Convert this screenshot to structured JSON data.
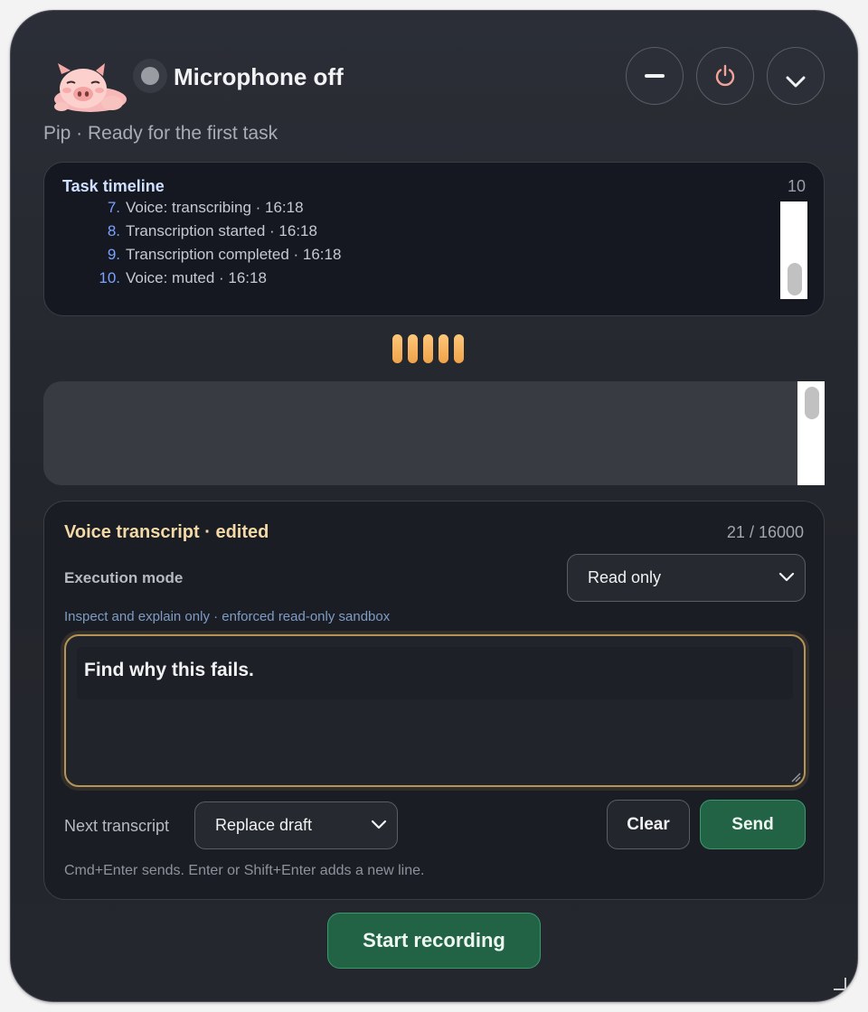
{
  "header": {
    "status_text": "Microphone off",
    "subtitle": "Pip · Ready for the first task",
    "buttons": [
      "minimize-icon",
      "power-icon",
      "chevron-down-icon"
    ],
    "colors": {
      "power_icon": "#f4a39a",
      "status_dot": "#9a9ca3"
    }
  },
  "timeline": {
    "title": "Task timeline",
    "count": "10",
    "items": [
      {
        "num": "7.",
        "text": "Voice: transcribing · 16:18"
      },
      {
        "num": "8.",
        "text": "Transcription started · 16:18"
      },
      {
        "num": "9.",
        "text": "Transcription completed · 16:18"
      },
      {
        "num": "10.",
        "text": "Voice: muted · 16:18"
      }
    ]
  },
  "transcript": {
    "title": "Voice transcript · edited",
    "char_count": "21 / 16000",
    "execution_mode_label": "Execution mode",
    "execution_mode_value": "Read only",
    "execution_hint": "Inspect and explain only · enforced read-only sandbox",
    "text": "Find why this fails.",
    "next_transcript_label": "Next transcript",
    "next_transcript_value": "Replace draft",
    "clear_label": "Clear",
    "send_label": "Send",
    "shortcut_hint": "Cmd+Enter sends. Enter or Shift+Enter adds a new line."
  },
  "record_button_label": "Start recording",
  "colors": {
    "accent_green": "#226346",
    "waveform": "#f0a24a",
    "transcript_title": "#f3d9a6",
    "timeline_title": "#cfe0ff"
  }
}
